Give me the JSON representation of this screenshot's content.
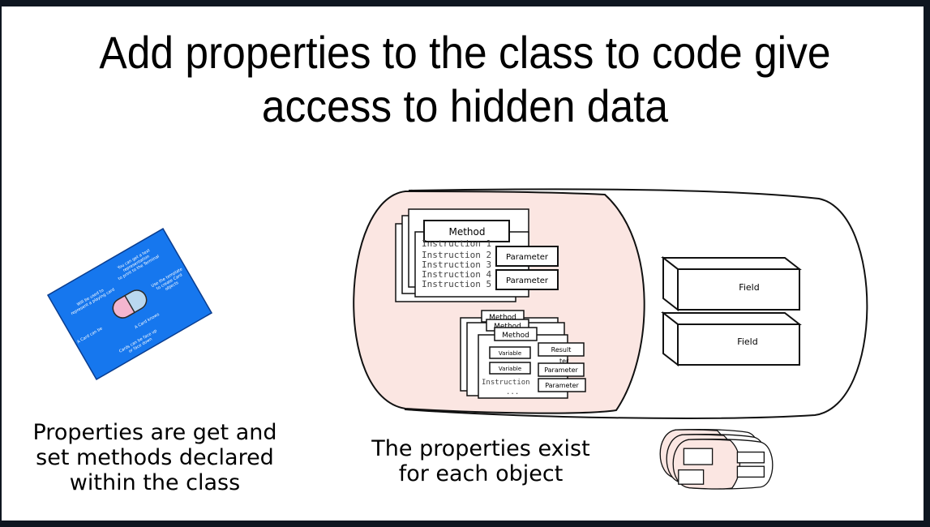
{
  "title": {
    "line1": "Add properties to the class to code give",
    "line2": "access to hidden data"
  },
  "captions": {
    "left": [
      "Properties are get and",
      "set methods declared",
      "within the class"
    ],
    "middle": [
      "The properties exist",
      "for each object"
    ]
  },
  "card": {
    "texts": [
      "You can get a text",
      "representation",
      "to print to the Terminal",
      "Will be used to",
      "represent a playing card",
      "Use the template",
      "to create Card",
      "objects",
      "A Card can be",
      "A Card knows",
      "Cards can be face up",
      "or face down"
    ]
  },
  "diagram": {
    "method1": {
      "label": "Method",
      "instructions": [
        "Instruction 1",
        "Instruction 2",
        "Instruction 3",
        "Instruction 4",
        "Instruction 5"
      ],
      "parameters": [
        "Parameter",
        "Parameter"
      ]
    },
    "method2": {
      "labels": [
        "Method",
        "Method",
        "Method"
      ],
      "variables": [
        "Variable",
        "Variable"
      ],
      "result": "Result",
      "parameters": [
        "Parameter",
        "Parameter"
      ],
      "instruction": "Instruction",
      "ellipsis": "...",
      "partial": "ter"
    },
    "fields": [
      "Field",
      "Field"
    ]
  },
  "colors": {
    "method_region": "#fbe6e2",
    "card_blue": "#1677ee",
    "background": "#0f1620"
  }
}
